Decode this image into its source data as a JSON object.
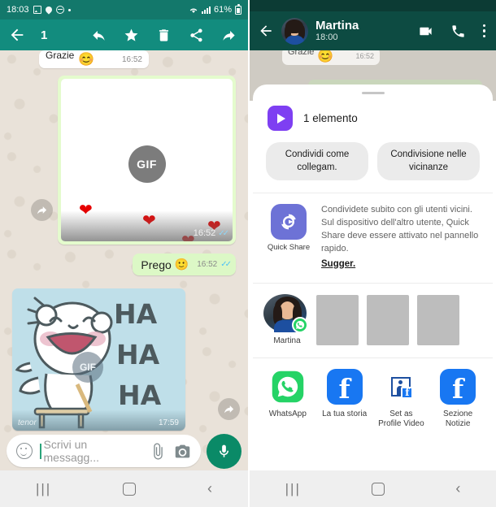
{
  "left": {
    "status_bar": {
      "time": "18:03",
      "battery": "61%",
      "icons": [
        "image-icon",
        "location-pin-icon",
        "do-not-disturb-icon",
        "dot-icon",
        "wifi-icon",
        "signal-icon",
        "battery-icon"
      ]
    },
    "selection_toolbar": {
      "back": "back-arrow-icon",
      "count": "1",
      "actions": [
        "reply-icon",
        "star-icon",
        "delete-icon",
        "share-icon",
        "forward-icon"
      ]
    },
    "messages": [
      {
        "text": "Grazie",
        "emoji": "😊",
        "time": "16:52"
      },
      {
        "type": "gif",
        "badge": "GIF",
        "time": "16:52",
        "hearts": [
          "❤",
          "❤",
          "❤",
          "❤"
        ]
      },
      {
        "text": "Prego",
        "emoji": "🙂",
        "time": "16:52"
      },
      {
        "type": "sticker",
        "badge": "GIF",
        "lines": [
          "HA",
          "HA",
          "HA"
        ],
        "watermark": "tenor",
        "time": "17:59"
      }
    ],
    "input_bar": {
      "placeholder": "Scrivi un messagg...",
      "emoji_icon": "emoji-icon",
      "attach_icon": "paperclip-icon",
      "camera_icon": "camera-icon",
      "mic_icon": "microphone-icon"
    },
    "nav_bar": {
      "recents": "|||",
      "home": "home-icon",
      "back": "‹"
    }
  },
  "right": {
    "header": {
      "back": "back-arrow-icon",
      "name": "Martina",
      "subtitle": "18:00",
      "video_icon": "video-call-icon",
      "call_icon": "phone-call-icon",
      "menu_icon": "overflow-menu-icon"
    },
    "dim_chat": {
      "text": "Grazie",
      "emoji": "😊",
      "time": "16:52"
    },
    "share_sheet": {
      "item_count": "1 elemento",
      "chips": [
        "Condividi come collegam.",
        "Condivisione nelle vicinanze"
      ],
      "quick_share": {
        "label": "Quick Share",
        "description": "Condividete subito con gli utenti vicini. Sul dispositivo dell'altro utente, Quick Share deve essere attivato nel pannello rapido.",
        "link": "Sugger."
      },
      "contacts": [
        {
          "name": "Martina",
          "badge": "whatsapp-icon"
        }
      ],
      "placeholder_count": 3,
      "apps": [
        {
          "name": "WhatsApp",
          "icon": "whatsapp-icon"
        },
        {
          "name": "La tua storia",
          "icon": "facebook-icon"
        },
        {
          "name": "Set as\nProfile Video",
          "icon": "set-profile-video-icon"
        },
        {
          "name": "Sezione\nNotizie",
          "icon": "facebook-icon"
        }
      ]
    },
    "nav_bar": {
      "recents": "|||",
      "home": "home-icon",
      "back": "‹"
    }
  },
  "colors": {
    "whatsapp_teal": "#128C7E",
    "header_dark": "#0d4b42",
    "bubble_green": "#dcf8c6",
    "quick_share_purple": "#6d72d6",
    "play_purple": "#7e3ff2",
    "whatsapp_green": "#25D366",
    "facebook_blue": "#1877F2"
  }
}
